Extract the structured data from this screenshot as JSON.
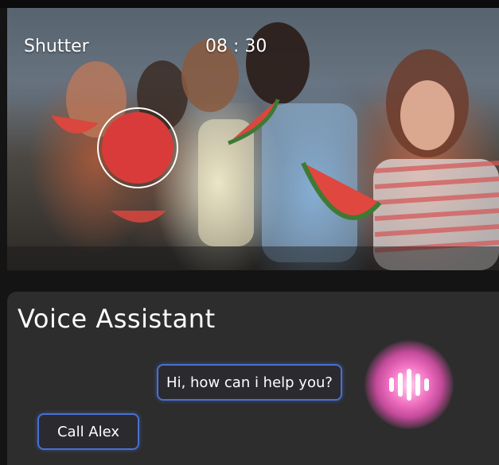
{
  "camera": {
    "mode_label": "Shutter",
    "timer": "08 : 30",
    "shutter_color": "#d93b3b"
  },
  "assistant": {
    "title": "Voice Assistant",
    "bot_message": "Hi, how can i help you?",
    "user_message": "Call Alex",
    "bubble_border_color": "#4a6fd1",
    "orb_color": "#f06fc0",
    "orb_icon": "voice-wave-icon"
  }
}
